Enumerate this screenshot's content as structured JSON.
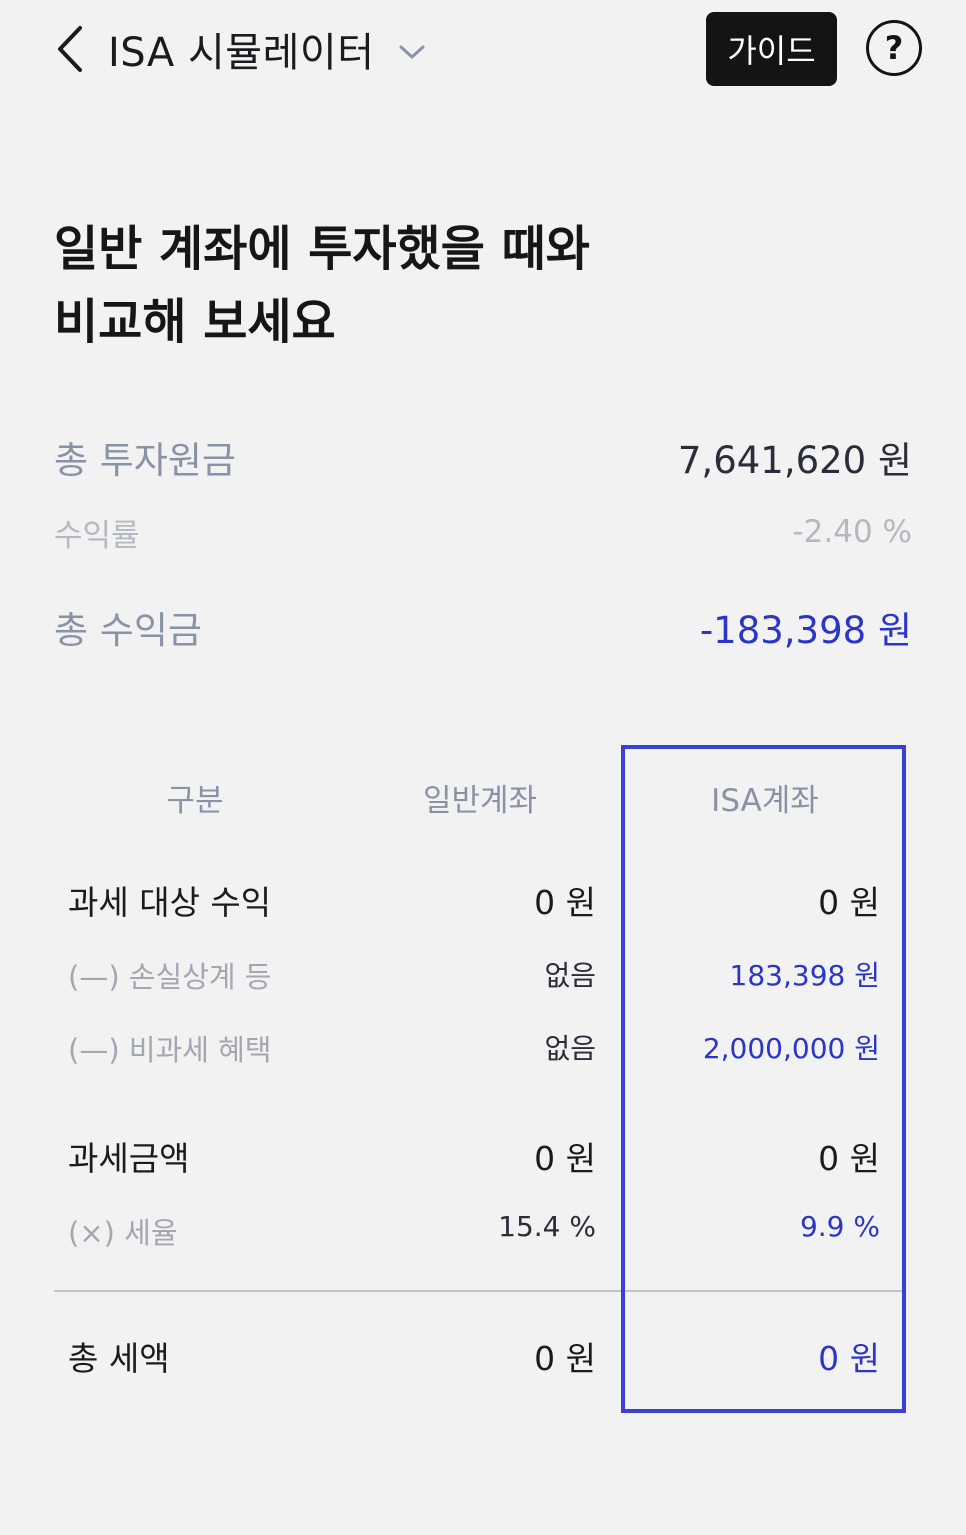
{
  "header": {
    "title": "ISA 시뮬레이터",
    "guide_label": "가이드",
    "help_label": "?"
  },
  "headline": {
    "line1": "일반 계좌에 투자했을 때와",
    "line2": "비교해 보세요"
  },
  "summary": {
    "principal_label": "총 투자원금",
    "principal_value": "7,641,620 원",
    "return_rate_label": "수익률",
    "return_rate_value": "-2.40 %",
    "total_profit_label": "총 수익금",
    "total_profit_value": "-183,398 원"
  },
  "table": {
    "headers": [
      "구분",
      "일반계좌",
      "ISA계좌"
    ],
    "rows": {
      "taxable_income": {
        "label": "과세 대상 수익",
        "general": "0 원",
        "isa": "0 원"
      },
      "loss_offset": {
        "label": "(—) 손실상계 등",
        "general": "없음",
        "isa": "183,398 원"
      },
      "tax_exempt": {
        "label": "(—) 비과세 혜택",
        "general": "없음",
        "isa": "2,000,000 원"
      },
      "taxable_amount": {
        "label": "과세금액",
        "general": "0 원",
        "isa": "0 원"
      },
      "tax_rate": {
        "label": "(×) 세율",
        "general": "15.4 %",
        "isa": "9.9 %"
      },
      "total_tax": {
        "label": "총 세액",
        "general": "0 원",
        "isa": "0 원"
      }
    }
  },
  "colors": {
    "accent_blue": "#2b36c9",
    "highlight_border": "#3a40d6",
    "background": "#f2f2f2",
    "guide_button": "#141414"
  },
  "icons": {
    "back": "chevron-left-icon",
    "dropdown": "chevron-down-icon",
    "help": "question-circle-icon"
  }
}
